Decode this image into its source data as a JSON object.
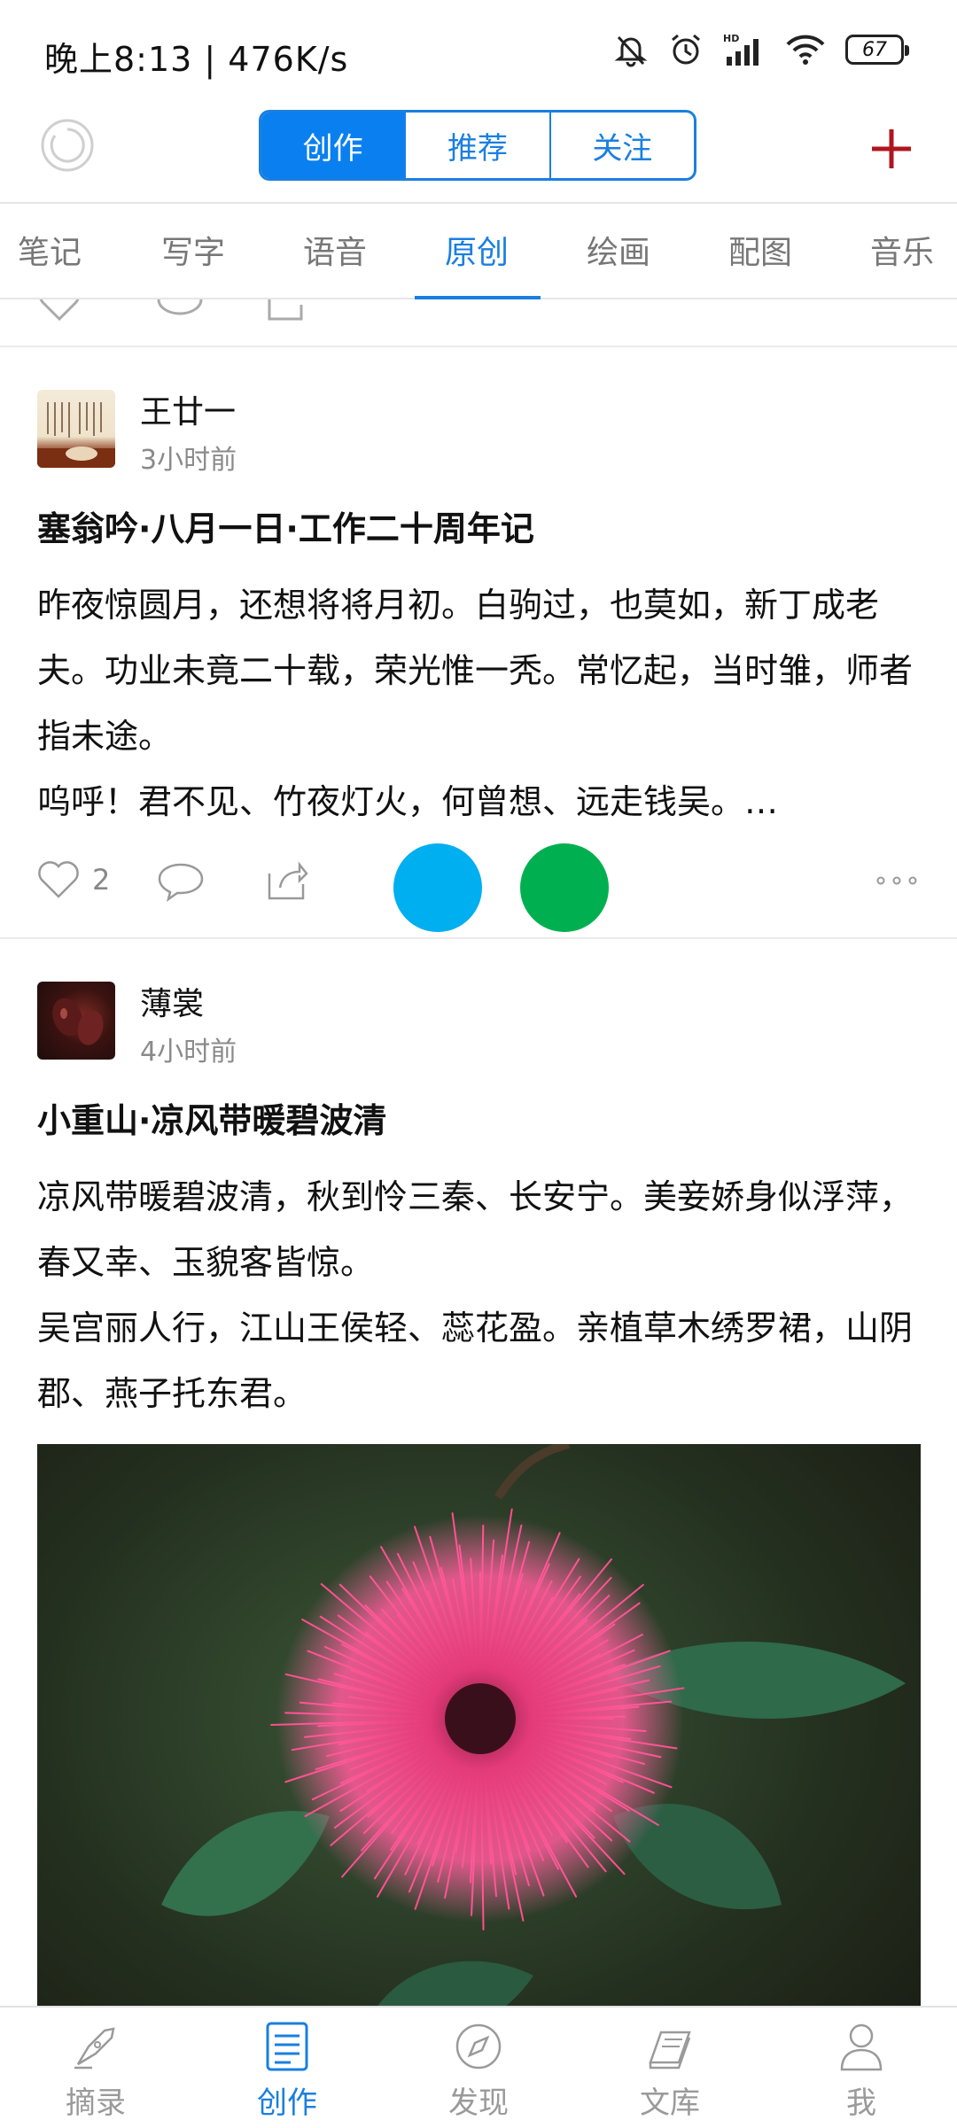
{
  "status_bar": {
    "time": "晚上8:13 | 476K/s",
    "battery": "67",
    "icons": [
      "mute-bell-icon",
      "alarm-icon",
      "hd-signal-icon",
      "wifi-icon",
      "battery-icon"
    ]
  },
  "header": {
    "segments": [
      {
        "label": "创作",
        "active": true
      },
      {
        "label": "推荐",
        "active": false
      },
      {
        "label": "关注",
        "active": false
      }
    ],
    "left_icon": "loading-ring-icon",
    "right_icon": "plus-icon"
  },
  "categories": [
    {
      "label": "笔记"
    },
    {
      "label": "写字"
    },
    {
      "label": "语音"
    },
    {
      "label": "原创",
      "active": true
    },
    {
      "label": "绘画"
    },
    {
      "label": "配图"
    },
    {
      "label": "音乐"
    }
  ],
  "posts": [
    {
      "author": "王廿一",
      "time": "3小时前",
      "title": "塞翁吟·八月一日·工作二十周年记",
      "body": "昨夜惊圆月，还想将将月初。白驹过，也莫如，新丁成老夫。功业未竟二十载，荣光惟一秃。常忆起，当时雏，师者指未途。\n呜呼！君不见、竹夜灯火，何曾想、远走钱吴。…",
      "likes": "2",
      "colors": {
        "blue_circle": "#00aff0",
        "green_circle": "#00b050"
      }
    },
    {
      "author": "薄裳",
      "time": "4小时前",
      "title": "小重山·凉风带暖碧波清",
      "body": "凉风带暖碧波清，秋到怜三秦、长安宁。美妾娇身似浮萍，春又幸、玉貌客皆惊。\n吴宫丽人行，江山王侯轻、蕊花盈。亲植草木绣罗裙，山阴郡、燕子托东君。",
      "image": "pink-puff-flower-photo"
    }
  ],
  "bottom_nav": [
    {
      "label": "摘录",
      "icon": "quill-icon"
    },
    {
      "label": "创作",
      "icon": "document-icon",
      "active": true
    },
    {
      "label": "发现",
      "icon": "compass-icon"
    },
    {
      "label": "文库",
      "icon": "books-icon"
    },
    {
      "label": "我",
      "icon": "person-icon"
    }
  ],
  "colors": {
    "accent": "#1a7fe0",
    "plus": "#b0161e"
  }
}
